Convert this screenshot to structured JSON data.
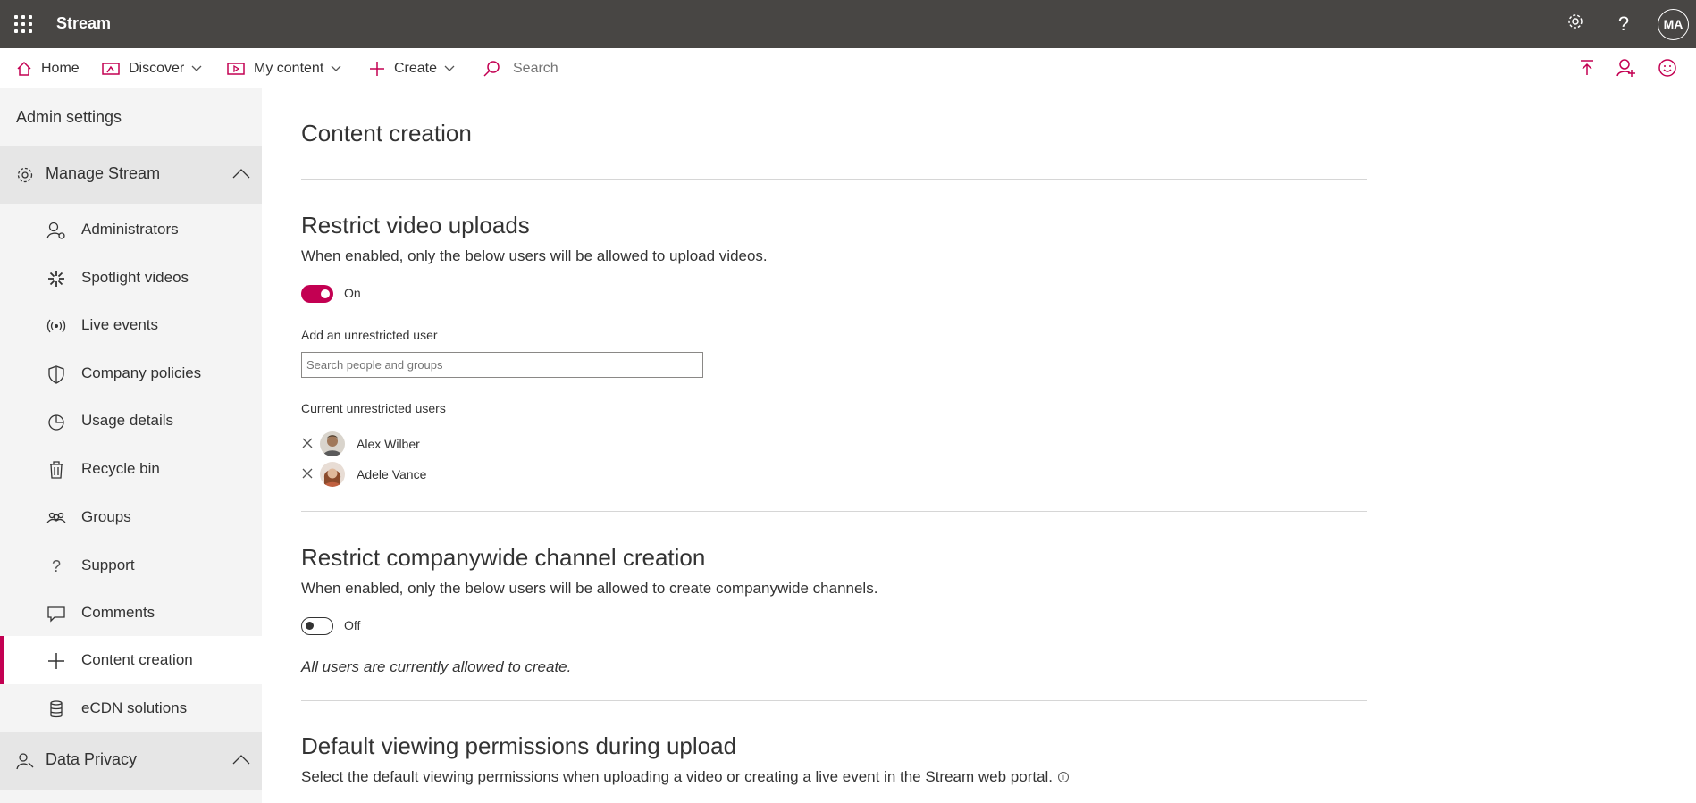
{
  "app": {
    "title": "Stream",
    "user_initials": "MA"
  },
  "nav": {
    "home": "Home",
    "discover": "Discover",
    "my_content": "My content",
    "create": "Create",
    "search_placeholder": "Search"
  },
  "sidebar": {
    "header": "Admin settings",
    "manage_group": "Manage Stream",
    "items": [
      {
        "label": "Administrators",
        "icon": "admin-icon"
      },
      {
        "label": "Spotlight videos",
        "icon": "spotlight-icon"
      },
      {
        "label": "Live events",
        "icon": "live-events-icon"
      },
      {
        "label": "Company policies",
        "icon": "shield-icon"
      },
      {
        "label": "Usage details",
        "icon": "pie-chart-icon"
      },
      {
        "label": "Recycle bin",
        "icon": "trash-icon"
      },
      {
        "label": "Groups",
        "icon": "groups-icon"
      },
      {
        "label": "Support",
        "icon": "question-icon"
      },
      {
        "label": "Comments",
        "icon": "comment-icon"
      },
      {
        "label": "Content creation",
        "icon": "plus-icon",
        "active": true
      },
      {
        "label": "eCDN solutions",
        "icon": "database-icon"
      }
    ],
    "privacy_group": "Data Privacy"
  },
  "main": {
    "title": "Content creation",
    "uploads": {
      "title": "Restrict video uploads",
      "desc": "When enabled, only the below users will be allowed to upload videos.",
      "toggle_state": "On",
      "add_label": "Add an unrestricted user",
      "search_placeholder": "Search people and groups",
      "current_label": "Current unrestricted users",
      "users": [
        "Alex Wilber",
        "Adele Vance"
      ]
    },
    "channels": {
      "title": "Restrict companywide channel creation",
      "desc": "When enabled, only the below users will be allowed to create companywide channels.",
      "toggle_state": "Off",
      "note": "All users are currently allowed to create."
    },
    "permissions": {
      "title": "Default viewing permissions during upload",
      "desc": "Select the default viewing permissions when uploading a video or creating a live event in the Stream web portal."
    }
  },
  "colors": {
    "accent": "#c30052",
    "topbar": "#484644"
  }
}
